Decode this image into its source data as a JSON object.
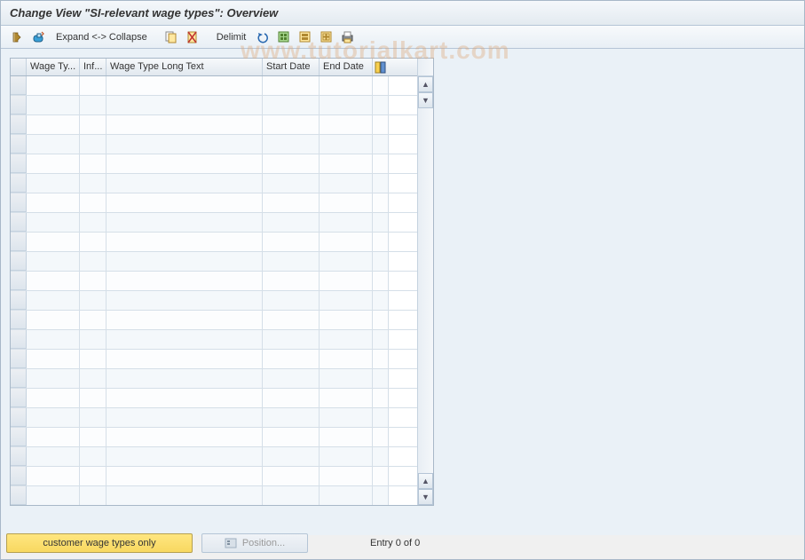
{
  "title": "Change View \"SI-relevant wage types\": Overview",
  "toolbar": {
    "expand_collapse": "Expand <-> Collapse",
    "delimit": "Delimit"
  },
  "columns": {
    "wage_type": "Wage Ty...",
    "info": "Inf...",
    "long_text": "Wage Type Long Text",
    "start_date": "Start Date",
    "end_date": "End Date"
  },
  "bottom": {
    "customer_only": "customer wage types only",
    "position": "Position...",
    "entry": "Entry 0 of 0"
  },
  "watermark": "www.tutorialkart.com",
  "row_count": 22
}
